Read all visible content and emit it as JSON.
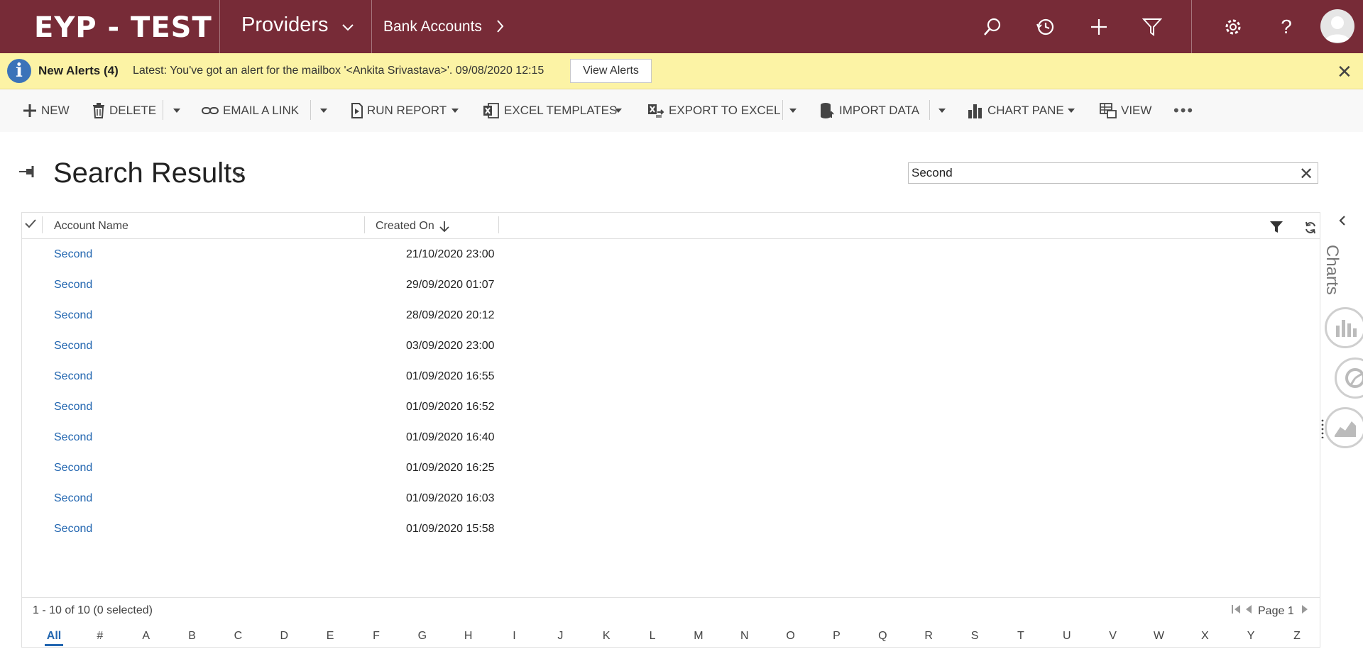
{
  "nav": {
    "brand": "EYP - TEST",
    "app": "Providers",
    "area": "Bank Accounts"
  },
  "alert": {
    "title": "New Alerts (4)",
    "message": "Latest: You've got an alert for the mailbox '<Ankita Srivastava>'. 09/08/2020 12:15",
    "button": "View Alerts"
  },
  "commands": {
    "new": "NEW",
    "delete": "DELETE",
    "email_link": "EMAIL A LINK",
    "run_report": "RUN REPORT",
    "excel_templates": "EXCEL TEMPLATES",
    "export_excel": "EXPORT TO EXCEL",
    "import_data": "IMPORT DATA",
    "chart_pane": "CHART PANE",
    "view": "VIEW"
  },
  "page": {
    "title": "Search Results",
    "search_value": "Second"
  },
  "grid": {
    "columns": [
      "Account Name",
      "Created On"
    ],
    "rows": [
      {
        "name": "Second",
        "created": "21/10/2020 23:00"
      },
      {
        "name": "Second",
        "created": "29/09/2020 01:07"
      },
      {
        "name": "Second",
        "created": "28/09/2020 20:12"
      },
      {
        "name": "Second",
        "created": "03/09/2020 23:00"
      },
      {
        "name": "Second",
        "created": "01/09/2020 16:55"
      },
      {
        "name": "Second",
        "created": "01/09/2020 16:52"
      },
      {
        "name": "Second",
        "created": "01/09/2020 16:40"
      },
      {
        "name": "Second",
        "created": "01/09/2020 16:25"
      },
      {
        "name": "Second",
        "created": "01/09/2020 16:03"
      },
      {
        "name": "Second",
        "created": "01/09/2020 15:58"
      }
    ],
    "record_count": "1 - 10 of 10 (0 selected)",
    "page_label": "Page 1",
    "letters": [
      "All",
      "#",
      "A",
      "B",
      "C",
      "D",
      "E",
      "F",
      "G",
      "H",
      "I",
      "J",
      "K",
      "L",
      "M",
      "N",
      "O",
      "P",
      "Q",
      "R",
      "S",
      "T",
      "U",
      "V",
      "W",
      "X",
      "Y",
      "Z"
    ]
  },
  "side": {
    "charts_label": "Charts"
  },
  "colors": {
    "nav_bg": "#772b37",
    "alert_bg": "#fcf3a5",
    "link": "#2266b0"
  }
}
